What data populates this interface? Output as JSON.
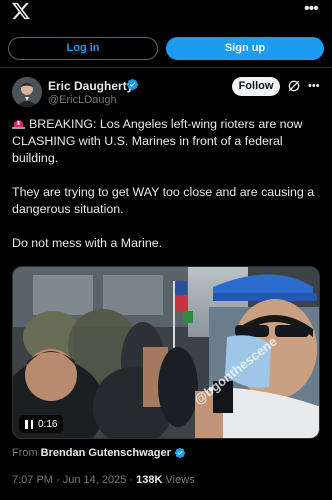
{
  "header": {
    "logo_icon": "x-logo-icon",
    "more_icon": "more-dots-icon"
  },
  "auth": {
    "login_label": "Log in",
    "signup_label": "Sign up"
  },
  "tweet": {
    "author": {
      "name": "Eric Daugherty",
      "handle": "@EricLDaugh",
      "verified": true
    },
    "follow_label": "Follow",
    "paragraphs": [
      "BREAKING: Los Angeles left-wing rioters are now CLASHING with U.S. Marines in front of a federal building.",
      "They are trying to get WAY too close and are causing a dangerous situation.",
      "Do not mess with a Marine."
    ],
    "lead_icon": "siren-icon",
    "media": {
      "duration": "0:16",
      "watermark": "@bgonthescene"
    },
    "source": {
      "prefix": "From",
      "name": "Brendan Gutenschwager"
    },
    "meta": {
      "time": "7:07 PM",
      "separator": " · ",
      "date": "Jun 14, 2025",
      "views_count": "138K",
      "views_label": "Views"
    }
  },
  "colors": {
    "accent": "#1d9bf0",
    "background": "#000000",
    "text": "#e7e9ea",
    "muted": "#71767b"
  }
}
